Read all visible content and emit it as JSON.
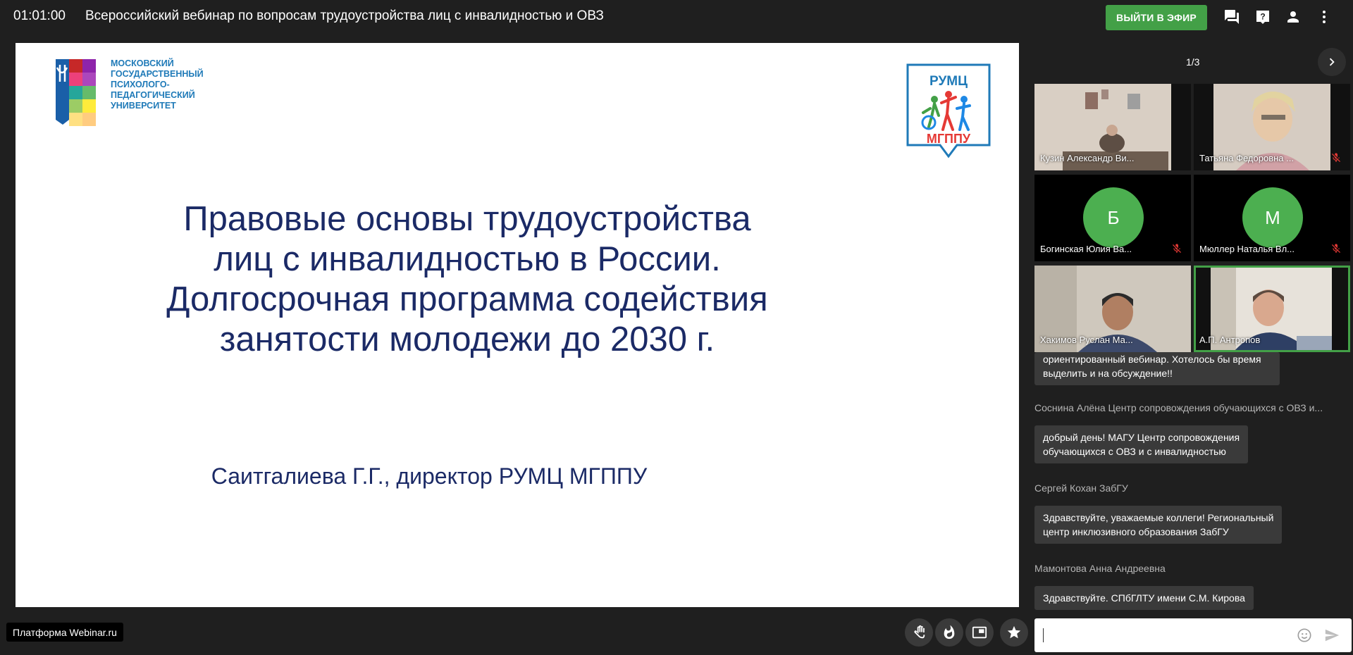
{
  "header": {
    "timer": "01:01:00",
    "title": "Всероссийский вебинар по вопросам трудоустройства лиц с инвалидностью и ОВЗ",
    "leave_label": "ВЫЙТИ В ЭФИР"
  },
  "slide": {
    "logo_lines": [
      "МОСКОВСКИЙ",
      "ГОСУДАРСТВЕННЫЙ",
      "ПСИХОЛОГО-",
      "ПЕДАГОГИЧЕСКИЙ",
      "УНИВЕРСИТЕТ"
    ],
    "rumc_top": "РУМЦ",
    "rumc_bottom": "МГППУ",
    "heading_lines": [
      "Правовые основы трудоустройства",
      "лиц с инвалидностью в России.",
      "Долгосрочная программа содействия",
      "занятости молодежи до 2030 г."
    ],
    "author": "Саитгалиева  Г.Г., директор  РУМЦ МГППУ"
  },
  "participants": {
    "page": "1/3",
    "tiles": [
      {
        "name": "Кузин Александр Ви...",
        "type": "video",
        "muted": false
      },
      {
        "name": "Татьяна Федоровна ...",
        "type": "video",
        "muted": true
      },
      {
        "name": "Богинская Юлия Ва...",
        "type": "avatar",
        "initial": "Б",
        "muted": true
      },
      {
        "name": "Мюллер Наталья Вл...",
        "type": "avatar",
        "initial": "М",
        "muted": true
      },
      {
        "name": "Хакимов Руслан Ма...",
        "type": "video",
        "muted": false
      },
      {
        "name": "А.П. Антропов",
        "type": "video",
        "muted": false,
        "active": true
      }
    ]
  },
  "chat": {
    "partial_line1": "ориентированный вебинар. Хотелось бы время",
    "partial_line2": "выделить и на обсуждение!!",
    "messages": [
      {
        "sender": "Соснина Алёна Центр сопровождения обучающихся с ОВЗ и...",
        "line1": "добрый день! МАГУ Центр сопровождения",
        "line2": "обучающихся с ОВЗ и с инвалидностью"
      },
      {
        "sender": "Сергей Кохан ЗабГУ",
        "line1": "Здравствуйте, уважаемые коллеги! Региональный",
        "line2": "центр инклюзивного образования ЗабГУ"
      },
      {
        "sender": "Мамонтова Анна Андреевна",
        "line1": "Здравствуйте. СПбГЛТУ имени С.М. Кирова"
      }
    ],
    "input_value": ""
  },
  "footer": {
    "platform_label": "Платформа Webinar.ru"
  },
  "colors": {
    "background": "#1f1f1f",
    "accent_green": "#43a047",
    "slide_text": "#1b2a66",
    "chat_bubble": "#3a3a3a"
  },
  "icons": [
    "chat-icon",
    "help-icon",
    "person-icon",
    "more-vert-icon",
    "chevron-right-icon",
    "mic-off-icon",
    "hand-icon",
    "fire-icon",
    "pip-icon",
    "star-icon",
    "emoji-icon",
    "send-icon"
  ]
}
